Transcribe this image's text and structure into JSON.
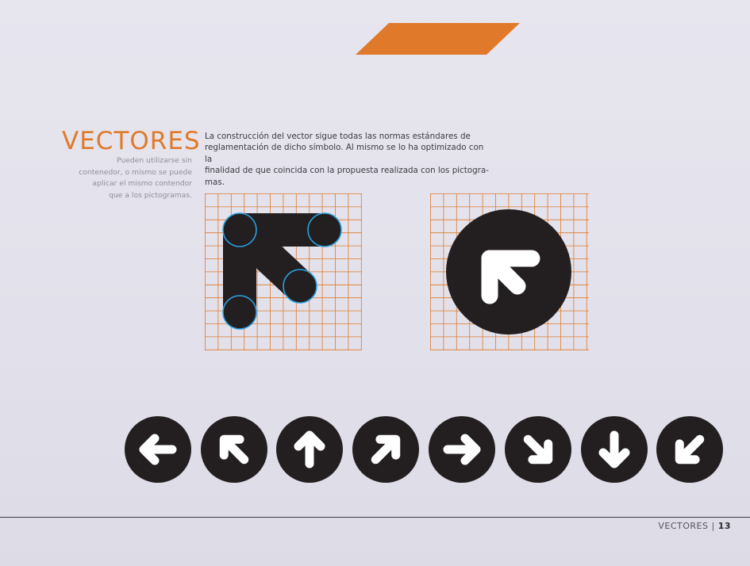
{
  "accent_color": "#e07a2a",
  "heading": "VECTORES",
  "subtitle": "Pueden utilizarse sin contenedor, o mismo se puede aplicar el mismo contendor que a los pictogramas.",
  "subtitle_lines": [
    "Pueden utilizarse sin",
    "contenedor, o mismo se puede",
    "aplicar el mismo contendor",
    "que a los pictogramas."
  ],
  "body_lines": [
    "La construcción del vector sigue todas las normas estándares de",
    "reglamentación de dicho símbolo. Al mismo se lo ha optimizado con la",
    "finalidad de que coincida con la propuesta realizada con los pictogra-",
    "mas."
  ],
  "figures": {
    "construction": {
      "icon": "arrow-up-left-construction",
      "guide_circle_color": "#2aa0e0"
    },
    "container": {
      "icon": "arrow-up-left-in-circle"
    }
  },
  "arrow_icons": [
    {
      "name": "arrow-left-icon",
      "angle": 180
    },
    {
      "name": "arrow-up-left-icon",
      "angle": 225
    },
    {
      "name": "arrow-up-icon",
      "angle": 270
    },
    {
      "name": "arrow-up-right-icon",
      "angle": 315
    },
    {
      "name": "arrow-right-icon",
      "angle": 0
    },
    {
      "name": "arrow-down-right-icon",
      "angle": 45
    },
    {
      "name": "arrow-down-icon",
      "angle": 90
    },
    {
      "name": "arrow-down-left-icon",
      "angle": 135
    }
  ],
  "footer": {
    "section": "VECTORES",
    "separator": "|",
    "page_number": "13"
  }
}
